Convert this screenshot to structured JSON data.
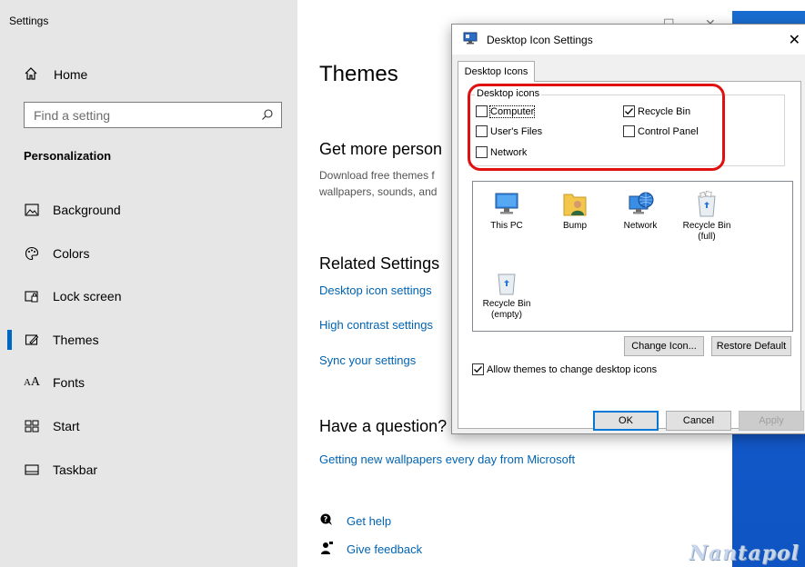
{
  "settings": {
    "window_title": "Settings",
    "home_label": "Home",
    "search_placeholder": "Find a setting",
    "section": "Personalization",
    "nav": [
      {
        "label": "Background",
        "icon": "picture-icon"
      },
      {
        "label": "Colors",
        "icon": "palette-icon"
      },
      {
        "label": "Lock screen",
        "icon": "lock-screen-icon"
      },
      {
        "label": "Themes",
        "icon": "brush-icon",
        "active": true
      },
      {
        "label": "Fonts",
        "icon": "fonts-icon"
      },
      {
        "label": "Start",
        "icon": "start-icon"
      },
      {
        "label": "Taskbar",
        "icon": "taskbar-icon"
      }
    ]
  },
  "content": {
    "title": "Themes",
    "get_more_heading": "Get more person",
    "get_more_desc": "Download free themes f wallpapers, sounds, and",
    "related_heading": "Related Settings",
    "related_links": [
      "Desktop icon settings",
      "High contrast settings",
      "Sync your settings"
    ],
    "question_heading": "Have a question?",
    "question_link": "Getting new wallpapers every day from Microsoft",
    "get_help": "Get help",
    "give_feedback": "Give feedback",
    "window_controls": {
      "minimize": "—",
      "maximize": "☐",
      "close": "✕"
    }
  },
  "dialog": {
    "title": "Desktop Icon Settings",
    "close": "✕",
    "tab": "Desktop Icons",
    "group_label": "Desktop icons",
    "checkboxes": [
      {
        "label": "Computer",
        "checked": false
      },
      {
        "label": "User's Files",
        "checked": false
      },
      {
        "label": "Network",
        "checked": false
      },
      {
        "label": "Recycle Bin",
        "checked": true
      },
      {
        "label": "Control Panel",
        "checked": false
      }
    ],
    "icons": [
      {
        "label": "This PC",
        "icon": "this-pc-icon"
      },
      {
        "label": "Bump",
        "icon": "user-folder-icon"
      },
      {
        "label": "Network",
        "icon": "network-icon"
      },
      {
        "label": "Recycle Bin (full)",
        "icon": "recycle-bin-full-icon"
      },
      {
        "label": "Recycle Bin (empty)",
        "icon": "recycle-bin-empty-icon"
      }
    ],
    "change_icon": "Change Icon...",
    "restore_default": "Restore Default",
    "allow_themes": "Allow themes to change desktop icons",
    "allow_themes_checked": true,
    "ok": "OK",
    "cancel": "Cancel",
    "apply": "Apply"
  },
  "watermark": "Nantapol",
  "colors": {
    "link": "#0063b1",
    "highlight": "#e01010",
    "accent": "#0067c0"
  }
}
